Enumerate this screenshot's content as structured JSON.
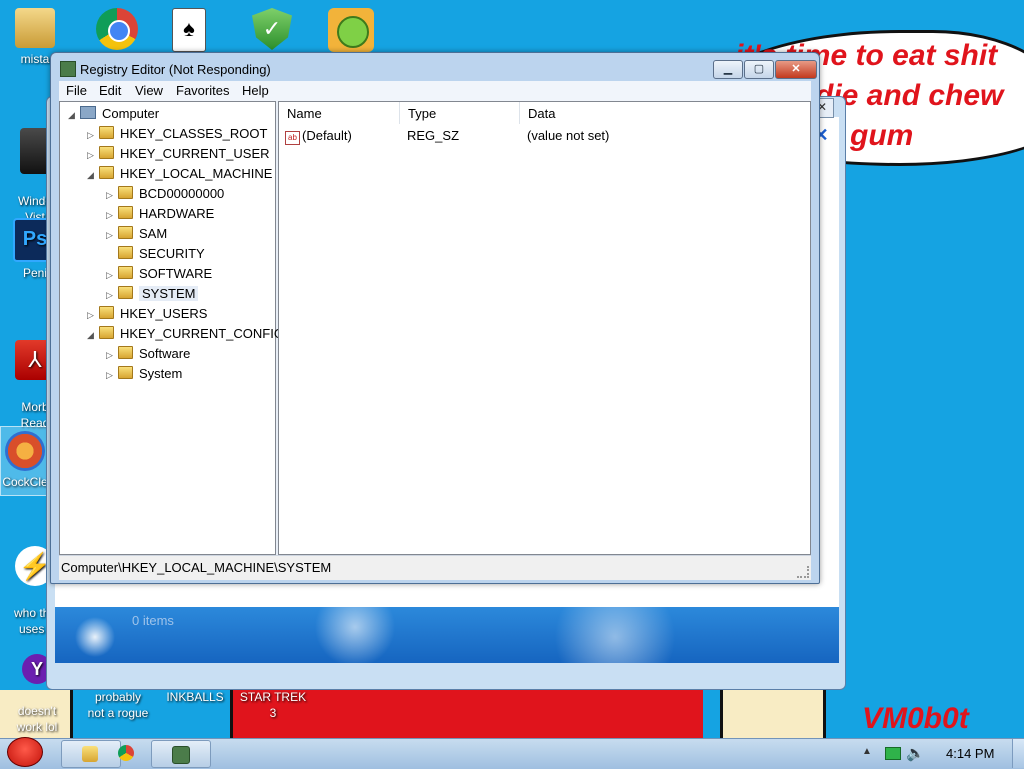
{
  "wallpaper": {
    "bubble_lines": [
      "it's time to eat shit",
      "die and chew",
      "gum"
    ],
    "signature": "VM0b0t"
  },
  "desktop_icons": [
    {
      "label": "mista",
      "icon": "folder-icon"
    },
    {
      "label": "Windo\nVist",
      "icon": "trash-icon"
    },
    {
      "label": "Peni",
      "icon": "photoshop-icon"
    },
    {
      "label": "Morb\nRead",
      "icon": "pdf-icon"
    },
    {
      "label": "CockCle",
      "icon": "ccleaner-icon"
    },
    {
      "label": "who the\nuses t",
      "icon": "winamp-icon"
    },
    {
      "label": "doesn't\nwork lol",
      "icon": "yahoo-icon"
    }
  ],
  "top_icons": [
    "chrome-icon",
    "solitaire-icon",
    "shield-icon",
    "bad-piggies-icon"
  ],
  "bottom_labels": [
    "probably\nnot a rogue",
    "INKBALLS",
    "STAR TREK\n3"
  ],
  "background_window": {
    "items_text": "0 items"
  },
  "regedit": {
    "title": "Registry Editor (Not Responding)",
    "menu": [
      "File",
      "Edit",
      "View",
      "Favorites",
      "Help"
    ],
    "tree": {
      "root": "Computer",
      "hkcr": "HKEY_CLASSES_ROOT",
      "hkcu": "HKEY_CURRENT_USER",
      "hklm": "HKEY_LOCAL_MACHINE",
      "hklm_children": [
        "BCD00000000",
        "HARDWARE",
        "SAM",
        "SECURITY",
        "SOFTWARE",
        "SYSTEM"
      ],
      "hku": "HKEY_USERS",
      "hkcc": "HKEY_CURRENT_CONFIG",
      "hkcc_children": [
        "Software",
        "System"
      ]
    },
    "columns": [
      "Name",
      "Type",
      "Data"
    ],
    "values": [
      {
        "name": "(Default)",
        "type": "REG_SZ",
        "data": "(value not set)"
      }
    ],
    "status_path": "Computer\\HKEY_LOCAL_MACHINE\\SYSTEM"
  },
  "taskbar": {
    "clock": "4:14 PM",
    "buttons": [
      "explorer-icon",
      "chrome-icon",
      "regedit-icon"
    ]
  }
}
